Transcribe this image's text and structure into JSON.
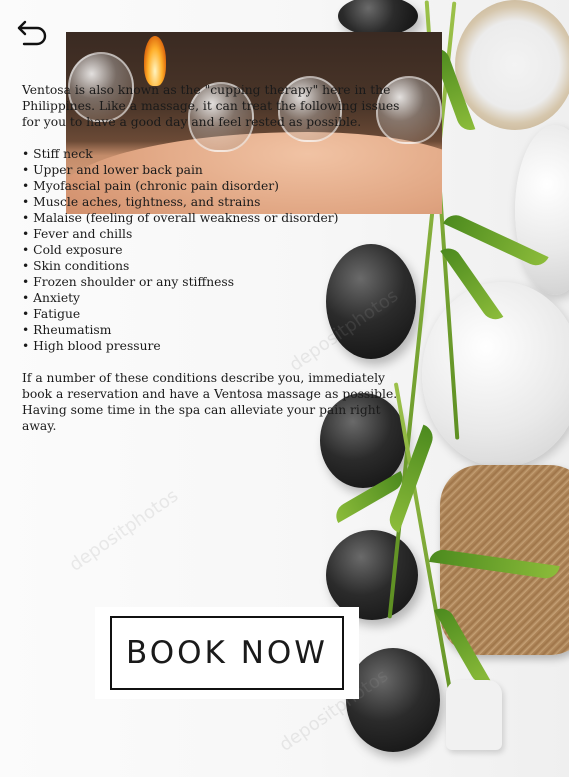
{
  "nav": {
    "back_icon": "back-arrow-icon"
  },
  "content": {
    "intro": "Ventosa is also known as the \"cupping therapy\" here in the Philippines. Like a massage, it can treat the following issues for you to have a good day and feel rested as possible.",
    "conditions": [
      "Stiff neck",
      "Upper and lower back pain",
      "Myofascial pain (chronic pain disorder)",
      "Muscle aches, tightness, and strains",
      "Malaise (feeling of overall weakness or disorder)",
      "Fever and chills",
      "Cold exposure",
      "Skin conditions",
      "Frozen shoulder or any stiffness",
      "Anxiety",
      "Fatigue",
      "Rheumatism",
      "High blood pressure"
    ],
    "closing": "If a number of these conditions describe you, immediately book a reservation and have a Ventosa massage as possible. Having some time in the spa can alleviate your pain right away."
  },
  "cta": {
    "book_label": "BOOK NOW"
  },
  "watermark": {
    "text": "depositphotos"
  }
}
